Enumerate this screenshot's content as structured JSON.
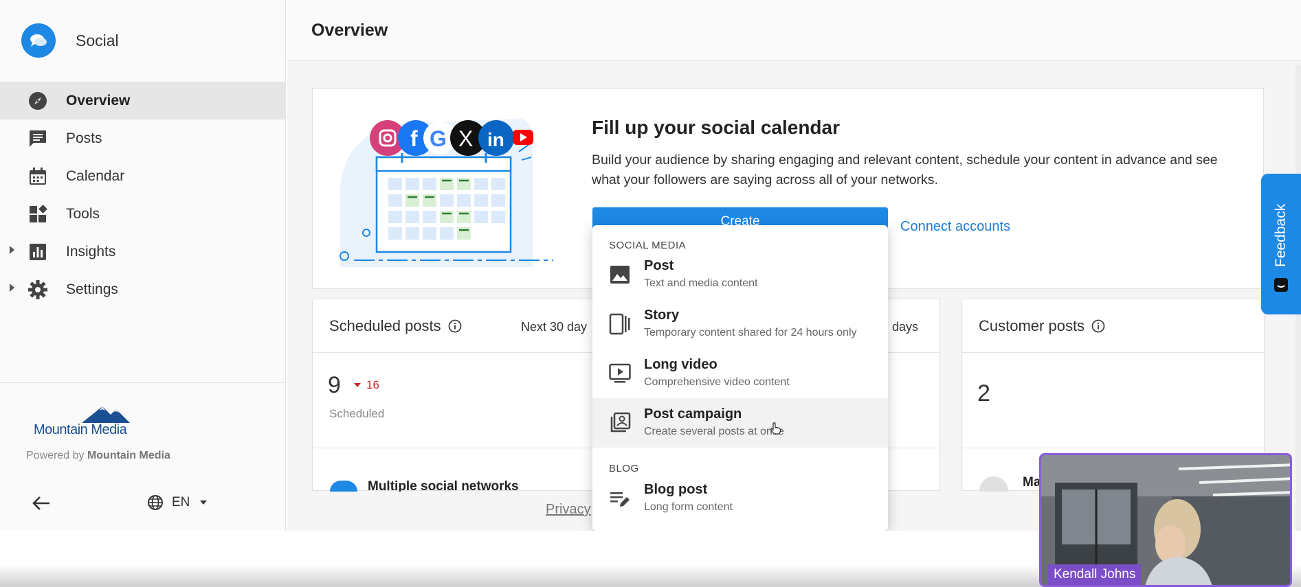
{
  "app": {
    "name": "Social"
  },
  "header": {
    "title": "Overview"
  },
  "sidebar": {
    "items": [
      {
        "label": "Overview",
        "icon": "compass-icon",
        "active": true
      },
      {
        "label": "Posts",
        "icon": "chat-icon"
      },
      {
        "label": "Calendar",
        "icon": "calendar-icon"
      },
      {
        "label": "Tools",
        "icon": "tools-icon"
      },
      {
        "label": "Insights",
        "icon": "bar-chart-icon",
        "expandable": true
      },
      {
        "label": "Settings",
        "icon": "gear-icon",
        "expandable": true
      }
    ],
    "brand_name": "Mountain Media",
    "powered_prefix": "Powered by",
    "powered_brand": "Mountain Media",
    "language": "EN"
  },
  "promo": {
    "title": "Fill up your social calendar",
    "text": "Build your audience by sharing engaging and relevant content, schedule your content in advance and see what your followers are saying across all of your networks.",
    "create_label": "Create",
    "connect_label": "Connect accounts"
  },
  "scheduled": {
    "title": "Scheduled posts",
    "range": "Next 30 day",
    "count": "9",
    "delta": "16",
    "label": "Scheduled",
    "row_text": "Multiple social networks"
  },
  "middle_card": {
    "range": ") days"
  },
  "customer": {
    "title": "Customer posts",
    "count": "2",
    "row_text": "Ma"
  },
  "footer": {
    "privacy": "Privacy"
  },
  "dropdown": {
    "section1": "SOCIAL MEDIA",
    "section2": "BLOG",
    "items": [
      {
        "label": "Post",
        "desc": "Text and media content",
        "icon": "image-icon"
      },
      {
        "label": "Story",
        "desc": "Temporary content shared for 24 hours only",
        "icon": "story-icon"
      },
      {
        "label": "Long video",
        "desc": "Comprehensive video content",
        "icon": "video-icon"
      },
      {
        "label": "Post campaign",
        "desc": "Create several posts at once",
        "icon": "campaign-icon"
      },
      {
        "label": "Blog post",
        "desc": "Long form content",
        "icon": "blog-icon"
      }
    ]
  },
  "feedback": {
    "label": "Feedback"
  },
  "video": {
    "name": "Kendall Johns"
  },
  "colors": {
    "accent": "#1e88e5",
    "negative": "#c62828",
    "video_border": "#8a5cd8"
  }
}
